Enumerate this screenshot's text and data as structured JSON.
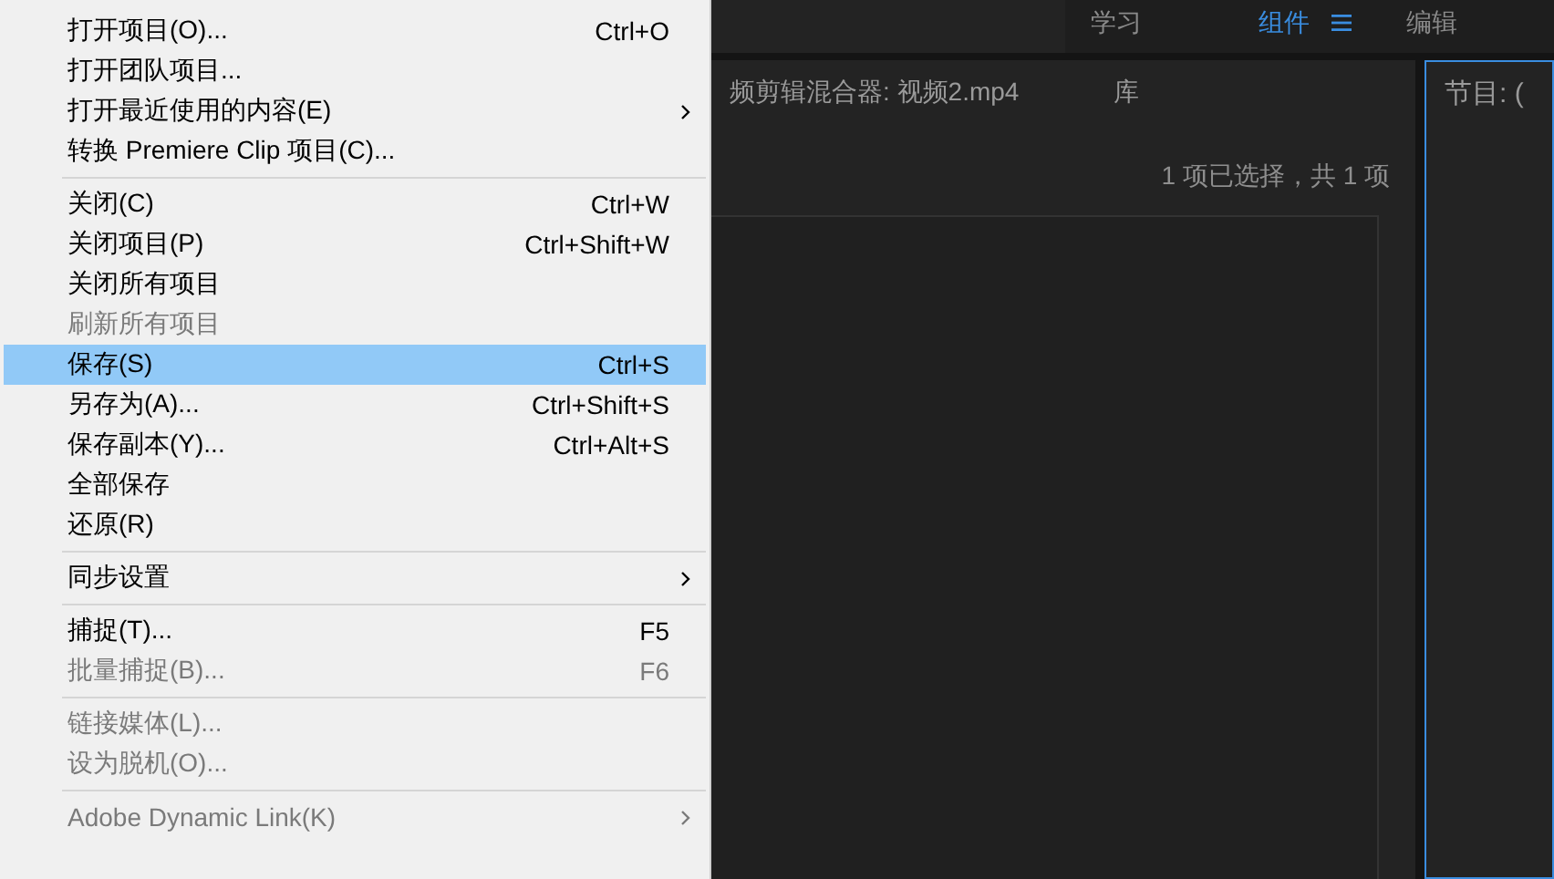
{
  "workspace_bar": {
    "tabs": [
      {
        "label": "学习",
        "selected": false
      },
      {
        "label": "组件",
        "selected": true,
        "menu": true
      },
      {
        "label": "编辑",
        "selected": false
      }
    ]
  },
  "panel": {
    "tabs": [
      {
        "label": "频剪辑混合器: 视频2.mp4"
      },
      {
        "label": "库"
      }
    ],
    "selection_info": "1 项已选择，共 1 项"
  },
  "program_panel": {
    "title": "节目: (",
    "focused": true
  },
  "file_menu": {
    "items": [
      {
        "kind": "item",
        "label": "打开项目(O)...",
        "shortcut": "Ctrl+O",
        "submenu": false,
        "disabled": false,
        "selected": false
      },
      {
        "kind": "item",
        "label": "打开团队项目...",
        "submenu": false,
        "disabled": false,
        "selected": false
      },
      {
        "kind": "item",
        "label": "打开最近使用的内容(E)",
        "submenu": true,
        "disabled": false,
        "selected": false
      },
      {
        "kind": "item",
        "label": "转换 Premiere Clip 项目(C)...",
        "submenu": false,
        "disabled": false,
        "selected": false
      },
      {
        "kind": "separator"
      },
      {
        "kind": "item",
        "label": "关闭(C)",
        "shortcut": "Ctrl+W",
        "submenu": false,
        "disabled": false,
        "selected": false
      },
      {
        "kind": "item",
        "label": "关闭项目(P)",
        "shortcut": "Ctrl+Shift+W",
        "submenu": false,
        "disabled": false,
        "selected": false
      },
      {
        "kind": "item",
        "label": "关闭所有项目",
        "submenu": false,
        "disabled": false,
        "selected": false
      },
      {
        "kind": "item",
        "label": "刷新所有项目",
        "submenu": false,
        "disabled": true,
        "selected": false
      },
      {
        "kind": "item",
        "label": "保存(S)",
        "shortcut": "Ctrl+S",
        "submenu": false,
        "disabled": false,
        "selected": true
      },
      {
        "kind": "item",
        "label": "另存为(A)...",
        "shortcut": "Ctrl+Shift+S",
        "submenu": false,
        "disabled": false,
        "selected": false
      },
      {
        "kind": "item",
        "label": "保存副本(Y)...",
        "shortcut": "Ctrl+Alt+S",
        "submenu": false,
        "disabled": false,
        "selected": false
      },
      {
        "kind": "item",
        "label": "全部保存",
        "submenu": false,
        "disabled": false,
        "selected": false
      },
      {
        "kind": "item",
        "label": "还原(R)",
        "submenu": false,
        "disabled": false,
        "selected": false
      },
      {
        "kind": "separator"
      },
      {
        "kind": "item",
        "label": "同步设置",
        "submenu": true,
        "disabled": false,
        "selected": false
      },
      {
        "kind": "separator"
      },
      {
        "kind": "item",
        "label": "捕捉(T)...",
        "shortcut": "F5",
        "submenu": false,
        "disabled": false,
        "selected": false
      },
      {
        "kind": "item",
        "label": "批量捕捉(B)...",
        "shortcut": "F6",
        "submenu": false,
        "disabled": true,
        "selected": false
      },
      {
        "kind": "separator"
      },
      {
        "kind": "item",
        "label": "链接媒体(L)...",
        "submenu": false,
        "disabled": true,
        "selected": false
      },
      {
        "kind": "item",
        "label": "设为脱机(O)...",
        "submenu": false,
        "disabled": true,
        "selected": false
      },
      {
        "kind": "separator"
      },
      {
        "kind": "item",
        "label": "Adobe Dynamic Link(K)",
        "submenu": true,
        "disabled": true,
        "selected": false
      }
    ]
  }
}
